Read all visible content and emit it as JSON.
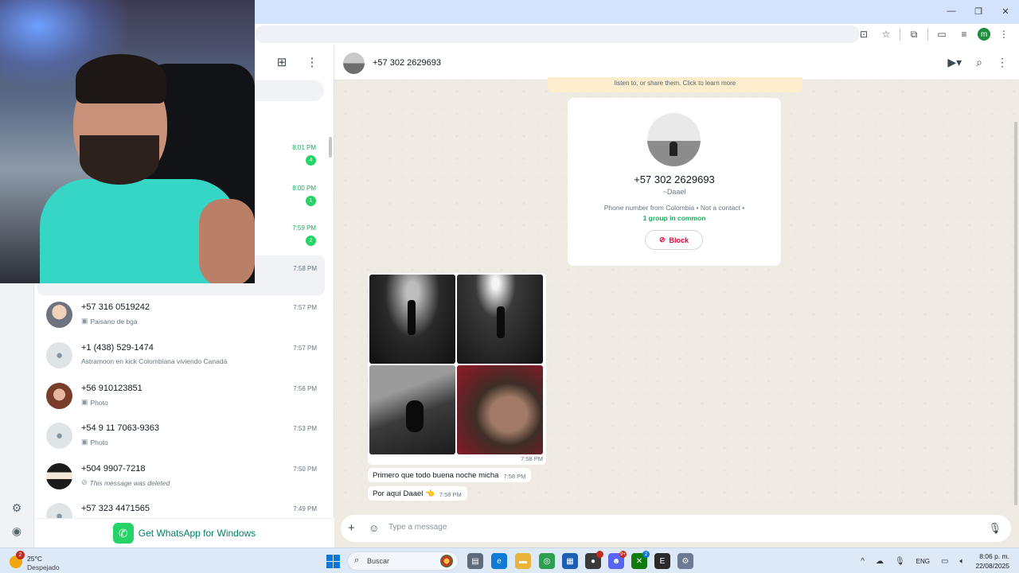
{
  "chat_list": {
    "get_app_label": "Get WhatsApp for Windows",
    "top_unread": [
      {
        "time": "8:01 PM",
        "count": "4"
      },
      {
        "time": "8:00 PM",
        "count": "1"
      },
      {
        "time": "7:59 PM",
        "count": "2"
      }
    ],
    "selected_time": "7:58 PM",
    "chats": [
      {
        "name": "+57 316 0519242",
        "time": "7:57 PM",
        "preview": "Paisano de bga",
        "icon": "photo-icon"
      },
      {
        "name": "+1 (438) 529-1474",
        "time": "7:57 PM",
        "preview": "Astramoon en kick  Colombiana viviendo Canadá",
        "icon": ""
      },
      {
        "name": "+56 910123851",
        "time": "7:56 PM",
        "preview": "Photo",
        "icon": "photo-icon"
      },
      {
        "name": "+54 9 11 7063-9363",
        "time": "7:53 PM",
        "preview": "Photo",
        "icon": "photo-icon"
      },
      {
        "name": "+504 9907-7218",
        "time": "7:50 PM",
        "preview": "This message was deleted",
        "icon": "blocked-icon"
      },
      {
        "name": "+57 323 4471565",
        "time": "7:49 PM",
        "preview": "",
        "icon": ""
      }
    ]
  },
  "conversation": {
    "title": "+57 302 2629693",
    "encryption_note": "listen to, or share them. Click to learn more",
    "contact_card": {
      "phone": "+57 302 2629693",
      "nickname": "~Daael",
      "info": "Phone number from Colombia • Not a contact •",
      "groups": "1 group in common",
      "block_label": "Block"
    },
    "album_time": "7:58 PM",
    "messages": [
      {
        "text": "Primero que todo buena noche micha",
        "time": "7:58 PM"
      },
      {
        "text": "Por aquí Daael 👈",
        "time": "7:58 PM"
      }
    ],
    "composer_placeholder": "Type a message"
  },
  "taskbar": {
    "weather_badge": "2",
    "temperature": "25°C",
    "condition": "Despejado",
    "search_label": "Buscar",
    "language": "ENG",
    "time": "8:06 p. m.",
    "date": "22/08/2025",
    "app_badges": [
      "9+",
      "2"
    ]
  },
  "browser": {
    "profile_initial": "m"
  },
  "colors": {
    "whatsapp_green": "#25d366",
    "unread_green": "#1daa61",
    "block_red": "#ea0038",
    "chat_bg": "#efeae2"
  }
}
